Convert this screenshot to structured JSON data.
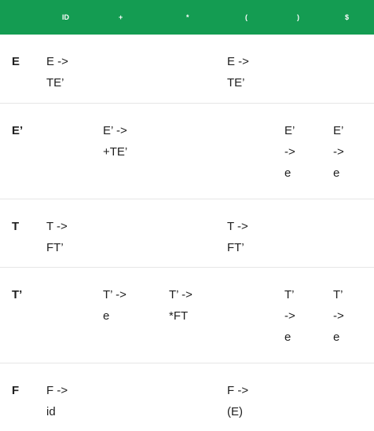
{
  "header": {
    "corner": "",
    "columns": [
      "ID",
      "+",
      "*",
      "(",
      ")",
      "$"
    ]
  },
  "rows": [
    {
      "nonterminal": "E",
      "cells": [
        [
          "E ->",
          "TE’"
        ],
        [],
        [],
        [
          "E ->",
          "TE’"
        ],
        [],
        []
      ]
    },
    {
      "nonterminal": "E’",
      "cells": [
        [],
        [
          "E’ ->",
          "+TE’"
        ],
        [],
        [],
        [
          "E’",
          "->",
          "e"
        ],
        [
          "E’",
          "->",
          "e"
        ]
      ]
    },
    {
      "nonterminal": "T",
      "cells": [
        [
          "T ->",
          "FT’"
        ],
        [],
        [],
        [
          "T ->",
          "FT’"
        ],
        [],
        []
      ]
    },
    {
      "nonterminal": "T’",
      "cells": [
        [],
        [
          "T’ ->",
          "e"
        ],
        [
          "T’ ->",
          "*FT"
        ],
        [],
        [
          "T’",
          "->",
          "e"
        ],
        [
          "T’",
          "->",
          "e"
        ]
      ]
    },
    {
      "nonterminal": "F",
      "cells": [
        [
          "F ->",
          "id"
        ],
        [],
        [],
        [
          "F ->",
          "(E)"
        ],
        [],
        []
      ]
    }
  ]
}
